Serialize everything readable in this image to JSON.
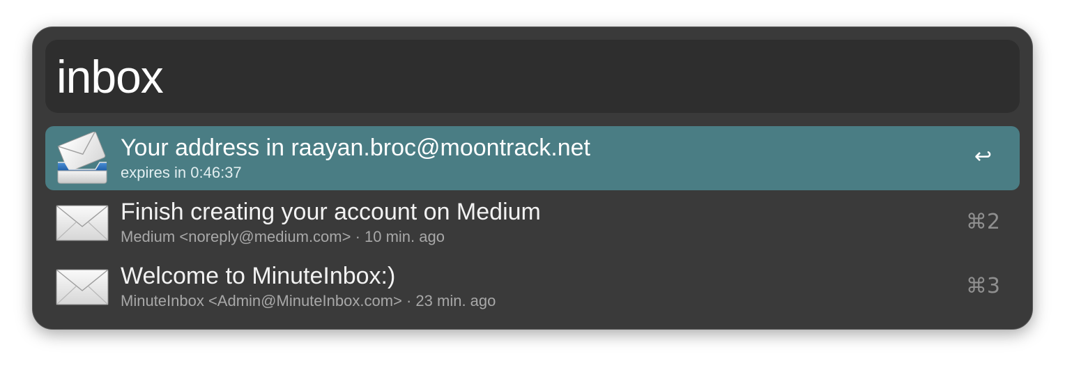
{
  "search": {
    "query": "inbox"
  },
  "results": [
    {
      "title": "Your address in raayan.broc@moontrack.net",
      "subtitle": "expires in 0:46:37",
      "shortcut": "↩",
      "icon": "mail-inbox-tray-icon",
      "selected": true
    },
    {
      "title": "Finish creating your account on Medium",
      "subtitle": "Medium <noreply@medium.com> · 10 min. ago",
      "shortcut": "⌘2",
      "icon": "envelope-icon",
      "selected": false
    },
    {
      "title": "Welcome to MinuteInbox:)",
      "subtitle": "MinuteInbox <Admin@MinuteInbox.com> · 23 min. ago",
      "shortcut": "⌘3",
      "icon": "envelope-icon",
      "selected": false
    }
  ],
  "colors": {
    "selection": "#4a7d84",
    "window": "#3a3a3a",
    "searchField": "#2e2e2e"
  }
}
